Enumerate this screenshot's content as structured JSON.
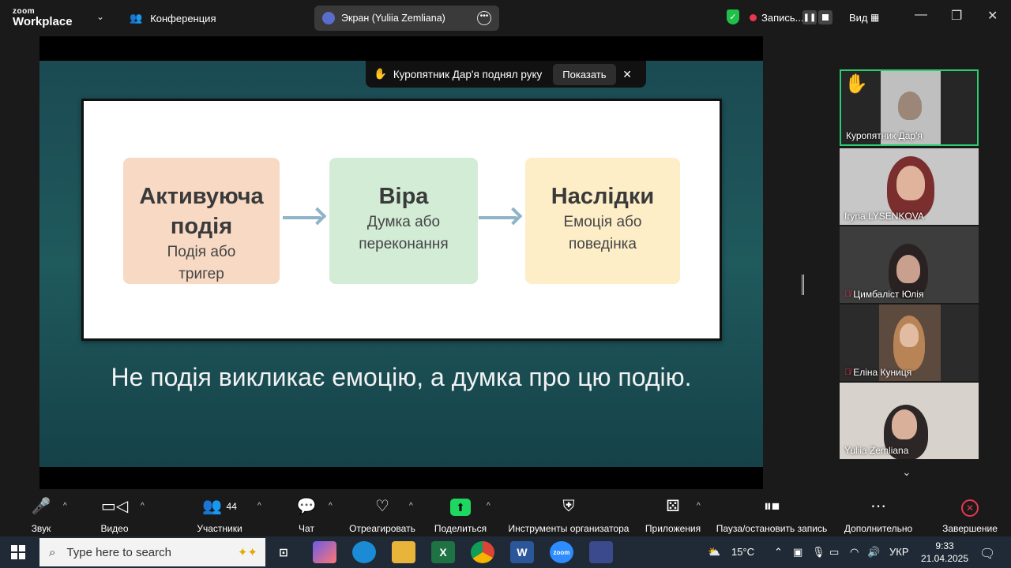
{
  "topbar": {
    "logo_top": "zoom",
    "logo_bottom": "Workplace",
    "conference_label": "Конференция",
    "screen_share_label": "Экран (Yuliia Zemliana)",
    "record_label": "Запись...",
    "view_label": "Вид"
  },
  "notification": {
    "text": "Куропятник Дар'я поднял руку",
    "show_button": "Показать"
  },
  "slide": {
    "box1_title": "Активуюча подія",
    "box1_sub": "Подія або тригер",
    "box2_title": "Віра",
    "box2_sub": "Думка або переконання",
    "box3_title": "Наслідки",
    "box3_sub": "Емоція або поведінка",
    "caption": "Не подія викликає емоцію, а думка про цю подію.",
    "colors": {
      "box1": "#f7d9c4",
      "box2": "#d3ecd6",
      "box3": "#fdeec8"
    }
  },
  "participants": [
    {
      "name": "Куропятник Дар'я",
      "hand_raised": true,
      "muted": false
    },
    {
      "name": "Iryna LYSENKOVA",
      "muted": false
    },
    {
      "name": "Цимбаліст Юлія",
      "muted": true
    },
    {
      "name": "Еліна Куниця",
      "muted": true
    },
    {
      "name": "Yuliia Zemliana",
      "muted": false
    }
  ],
  "toolbar": {
    "audio": "Звук",
    "video": "Видео",
    "participants": "Участники",
    "participants_count": "44",
    "chat": "Чат",
    "react": "Отреагировать",
    "share": "Поделиться",
    "host_tools": "Инструменты организатора",
    "apps": "Приложения",
    "pause_record": "Пауза/остановить запись",
    "more": "Дополнительно",
    "end": "Завершение"
  },
  "taskbar": {
    "search_placeholder": "Type here to search",
    "temperature": "15°C",
    "language": "УКР",
    "time": "9:33",
    "date": "21.04.2025"
  },
  "accent": {
    "green": "#1fbf4a",
    "red": "#e8384f",
    "share_green": "#1ed760"
  }
}
